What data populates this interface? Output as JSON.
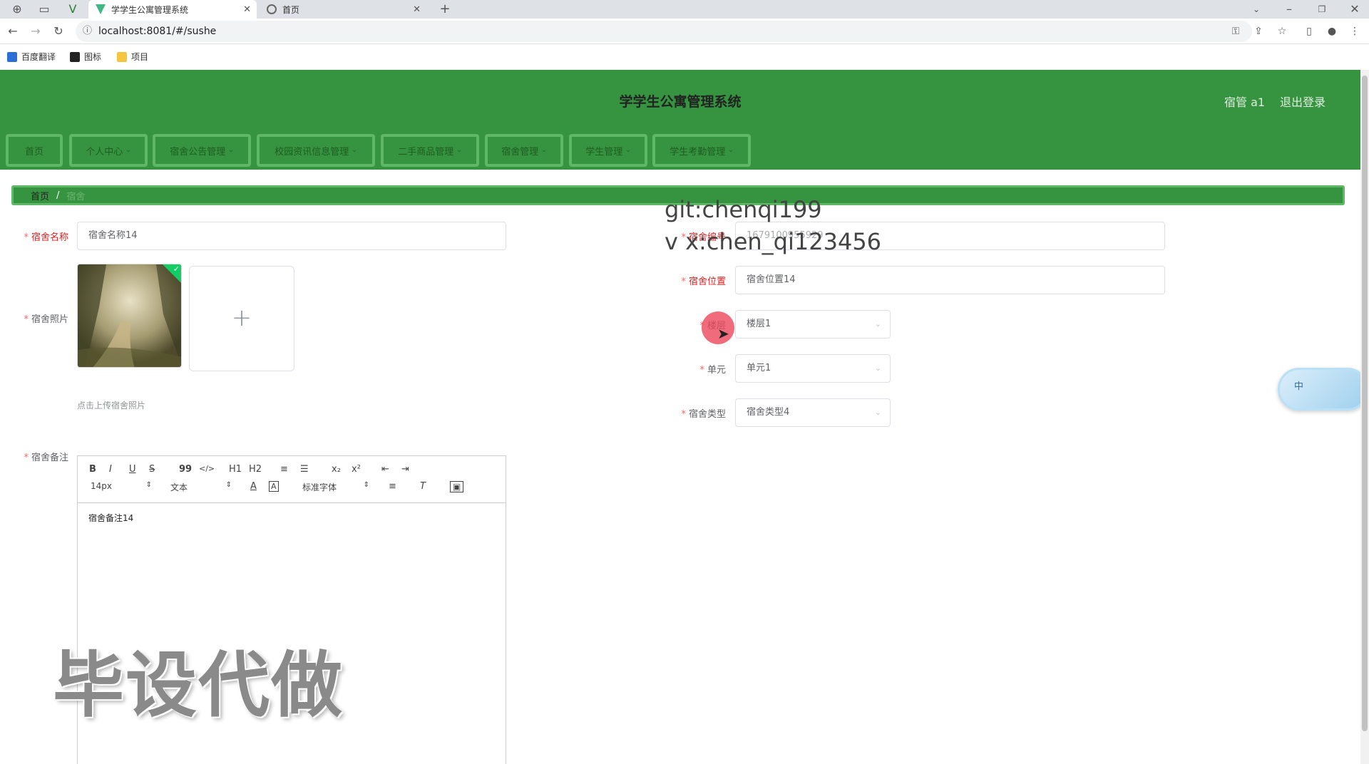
{
  "browser": {
    "tabs": [
      {
        "label": "学学生公寓管理系统",
        "active": true
      },
      {
        "label": "首页",
        "active": false
      }
    ],
    "url": "localhost:8081/#/sushe",
    "bookmarks": [
      "百度翻译",
      "图标",
      "项目"
    ]
  },
  "header": {
    "title": "学学生公寓管理系统",
    "user": "宿管 a1",
    "logout": "退出登录"
  },
  "nav": {
    "items": [
      {
        "label": "首页",
        "caret": false
      },
      {
        "label": "个人中心",
        "caret": true
      },
      {
        "label": "宿舍公告管理",
        "caret": true
      },
      {
        "label": "校园资讯信息管理",
        "caret": true
      },
      {
        "label": "二手商品管理",
        "caret": true
      },
      {
        "label": "宿舍管理",
        "caret": true
      },
      {
        "label": "学生管理",
        "caret": true
      },
      {
        "label": "学生考勤管理",
        "caret": true
      }
    ]
  },
  "breadcrumb": {
    "home": "首页",
    "sep": "/",
    "current": "宿舍"
  },
  "form": {
    "name_label": "宿舍名称",
    "name_value": "宿舍名称14",
    "code_label": "宿舍编号",
    "code_value": "1679100955929",
    "photo_label": "宿舍照片",
    "photo_hint": "点击上传宿舍照片",
    "location_label": "宿舍位置",
    "location_value": "宿舍位置14",
    "floor_label": "楼层",
    "floor_value": "楼层1",
    "unit_label": "单元",
    "unit_value": "单元1",
    "type_label": "宿舍类型",
    "type_value": "宿舍类型4",
    "remark_label": "宿舍备注",
    "remark_value": "宿舍备注14"
  },
  "editor": {
    "font_size": "14px",
    "format": "文本",
    "font": "标准字体",
    "buttons": [
      "B",
      "I",
      "U",
      "S",
      "99",
      "</>",
      "H1",
      "H2",
      "≡",
      "☰",
      "x₂",
      "x²",
      "⇤",
      "⇥"
    ]
  },
  "watermarks": [
    "git:chenqi199",
    "v x:chen_qi123456",
    "毕设代做"
  ],
  "widget_label": "中"
}
